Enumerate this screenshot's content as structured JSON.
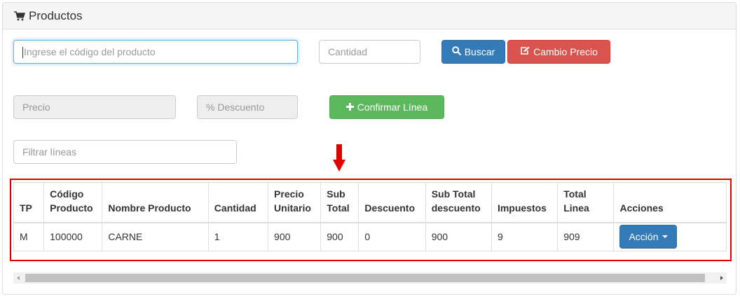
{
  "panel": {
    "title": "Productos",
    "icon": "shopping-cart-icon"
  },
  "form": {
    "codigo_placeholder": "Ingrese el código del producto",
    "cantidad_placeholder": "Cantidad",
    "buscar_label": "Buscar",
    "cambio_precio_label": "Cambio Precio",
    "precio_placeholder": "Precio",
    "descuento_placeholder": "% Descuento",
    "confirmar_label": "Confirmar Línea",
    "filtrar_placeholder": "Filtrar líneas"
  },
  "table": {
    "headers": {
      "tp": "TP",
      "codigo_1": "Código",
      "codigo_2": "Producto",
      "nombre": "Nombre Producto",
      "cantidad": "Cantidad",
      "precio_1": "Precio",
      "precio_2": "Unitario",
      "subtotal_1": "Sub",
      "subtotal_2": "Total",
      "descuento": "Descuento",
      "subtotal_desc_1": "Sub Total",
      "subtotal_desc_2": "descuento",
      "impuestos": "Impuestos",
      "total_1": "Total",
      "total_2": "Linea",
      "acciones": "Acciones"
    },
    "rows": [
      {
        "tp": "M",
        "codigo": "100000",
        "nombre": "CARNE",
        "cantidad": "1",
        "precio_unitario": "900",
        "sub_total": "900",
        "descuento": "0",
        "sub_total_descuento": "900",
        "impuestos": "9",
        "total_linea": "909",
        "accion_label": "Acción"
      }
    ]
  },
  "colors": {
    "primary": "#337ab7",
    "danger": "#d9534f",
    "success": "#5cb85c",
    "highlight": "#e00000"
  }
}
